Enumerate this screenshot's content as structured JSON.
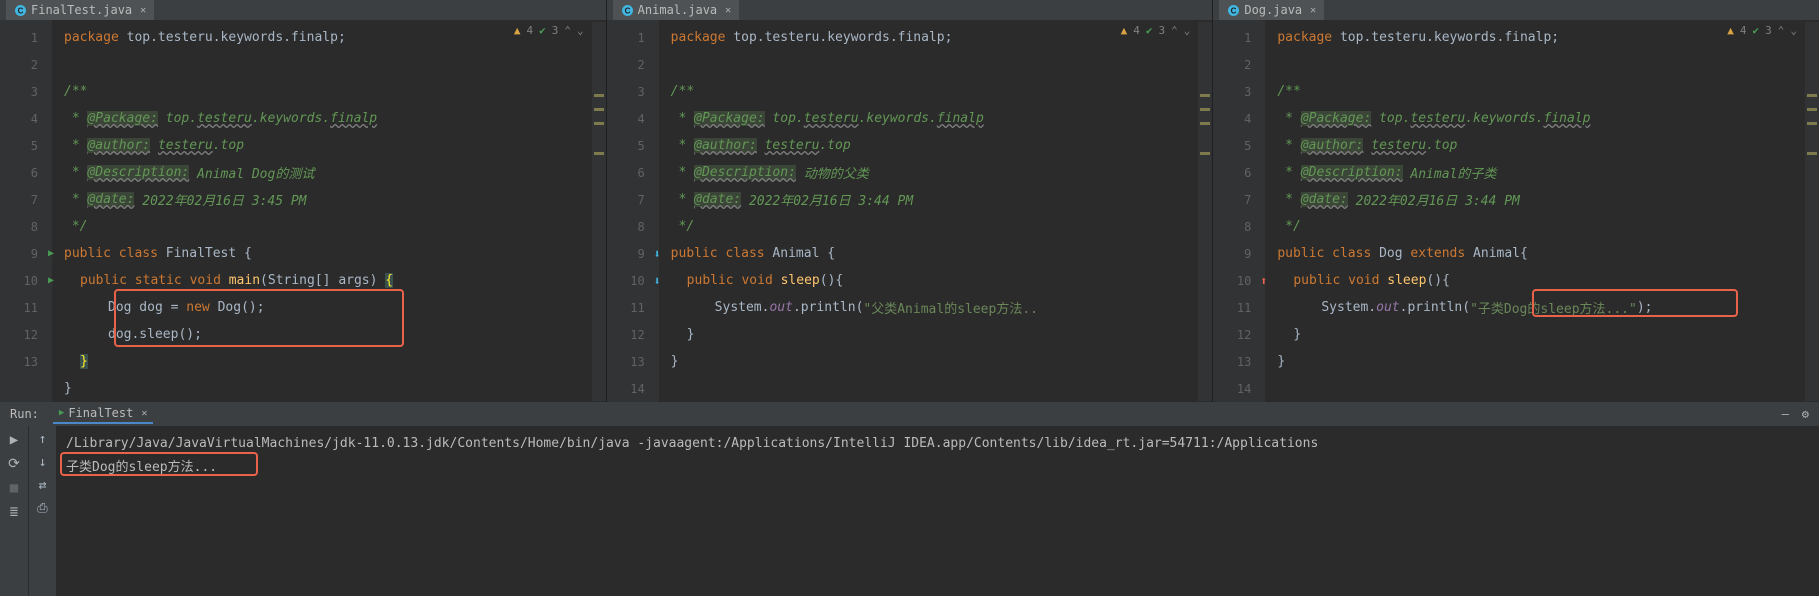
{
  "tabs": {
    "a": "FinalTest.java",
    "b": "Animal.java",
    "c": "Dog.java"
  },
  "alerts": {
    "warn_count": "4",
    "ok_count": "3"
  },
  "pane_a": {
    "l1_pkg": "package",
    "l1_pkgname": " top.testeru.keywords.finalp;",
    "l3": "/**",
    "l4_tag": "@Package:",
    "l4_rest": " top.",
    "l4_link": "testeru",
    "l4_rest2": ".keywords.",
    "l4_link2": "finalp",
    "l5_tag": "@author:",
    "l5_link": "testeru",
    "l5_rest": ".top",
    "l6_tag": "@Description:",
    "l6_rest": " Animal Dog的测试",
    "l7_tag": "@date:",
    "l7_rest": " 2022年02月16日 3:45 PM",
    "l8": " */",
    "l9_a": "public",
    "l9_b": " class",
    "l9_c": " FinalTest {",
    "l10_a": "public",
    "l10_b": " static",
    "l10_c": " void",
    "l10_d": " main",
    "l10_e": "(String[] args) ",
    "l10_f": "{",
    "l11_a": "Dog dog = ",
    "l11_b": "new",
    "l11_c": " Dog();",
    "l12": "dog.sleep();",
    "l13": "}",
    "l14": "}"
  },
  "pane_b": {
    "l6_rest": " 动物的父类",
    "l7_rest": " 2022年02月16日 3:44 PM",
    "l9_c": " Animal {",
    "l10_a": "public",
    "l10_b": " void",
    "l10_c": " sleep",
    "l10_d": "(){",
    "l11_a": "System.",
    "l11_b": "out",
    "l11_c": ".println(",
    "l11_d": "\"父类Animal的sleep方法..",
    "l12": "}"
  },
  "pane_c": {
    "l6_rest": " Animal的子类",
    "l9_c": " Dog ",
    "l9_d": "extends",
    "l9_e": " Animal{",
    "l11_d": "\"子类Dog的sleep方法...\"",
    "l11_e": ");"
  },
  "run": {
    "label": "Run:",
    "tab": "FinalTest",
    "line1": "/Library/Java/JavaVirtualMachines/jdk-11.0.13.jdk/Contents/Home/bin/java -javaagent:/Applications/IntelliJ IDEA.app/Contents/lib/idea_rt.jar=54711:/Applications",
    "line2": "子类Dog的sleep方法..."
  }
}
